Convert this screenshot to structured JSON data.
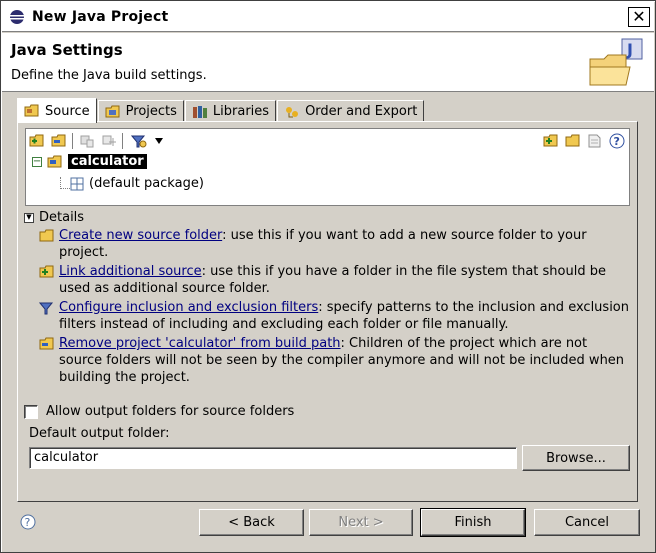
{
  "window": {
    "title": "New Java Project",
    "close_label": "✕"
  },
  "header": {
    "title": "Java Settings",
    "description": "Define the Java build settings."
  },
  "tabs": [
    {
      "label": "Source",
      "icon": "source-folder-icon",
      "active": true
    },
    {
      "label": "Projects",
      "icon": "projects-icon",
      "active": false
    },
    {
      "label": "Libraries",
      "icon": "libraries-icon",
      "active": false
    },
    {
      "label": "Order and Export",
      "icon": "order-export-icon",
      "active": false
    }
  ],
  "tree": {
    "project": "calculator",
    "package": "(default package)"
  },
  "details": {
    "header": "Details",
    "items": [
      {
        "link": "Create new source folder",
        "text": ": use this if you want to add a new source folder to your project."
      },
      {
        "link": "Link additional source",
        "text": ": use this if you have a folder in the file system that should be used as additional source folder."
      },
      {
        "link": "Configure inclusion and exclusion filters",
        "text": ": specify patterns to the inclusion and exclusion filters instead of including and excluding each folder or file manually."
      },
      {
        "link": "Remove project 'calculator' from build path",
        "text": ": Children of the project which are not source folders will not be seen by the compiler anymore and will not be included when building the project."
      }
    ]
  },
  "options": {
    "allow_output_folders_label": "Allow output folders for source folders",
    "allow_output_folders_checked": false
  },
  "output": {
    "label": "Default output folder:",
    "value": "calculator",
    "browse_label": "Browse..."
  },
  "buttons": {
    "back": "< Back",
    "next": "Next >",
    "finish": "Finish",
    "cancel": "Cancel"
  }
}
